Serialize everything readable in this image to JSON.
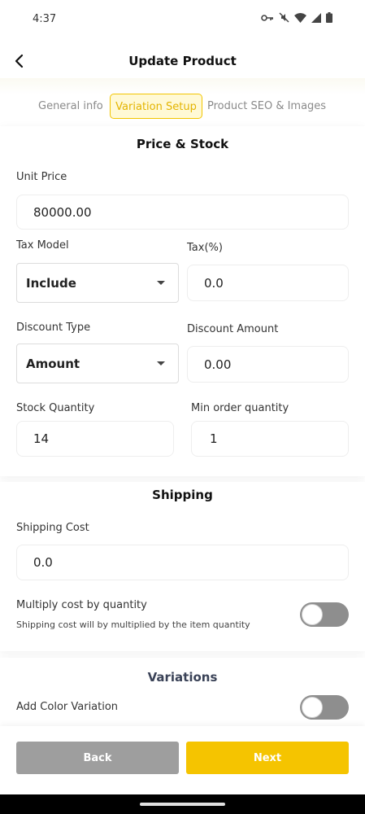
{
  "status_bar": {
    "time": "4:37",
    "icons": [
      "key-icon",
      "mute-icon",
      "wifi-icon",
      "signal-icon",
      "battery-icon"
    ]
  },
  "header": {
    "title": "Update Product",
    "back_icon": "back-arrow-icon"
  },
  "tabs": [
    {
      "label": "General info",
      "active": false
    },
    {
      "label": "Variation Setup",
      "active": true
    },
    {
      "label": "Product SEO & Images",
      "active": false
    }
  ],
  "price_stock": {
    "title": "Price & Stock",
    "unit_price": {
      "label": "Unit Price",
      "value": "80000.00"
    },
    "tax_model": {
      "label": "Tax Model",
      "value": "Include"
    },
    "tax": {
      "label": "Tax(%)",
      "value": "0.0"
    },
    "discount_type": {
      "label": "Discount Type",
      "value": "Amount"
    },
    "discount_amount": {
      "label": "Discount Amount",
      "value": "0.00"
    },
    "stock_quantity": {
      "label": "Stock Quantity",
      "value": "14"
    },
    "min_order_quantity": {
      "label": "Min order quantity",
      "value": "1"
    }
  },
  "shipping": {
    "title": "Shipping",
    "cost": {
      "label": "Shipping Cost",
      "value": "0.0"
    },
    "multiply": {
      "label": "Multiply cost by quantity",
      "note": "Shipping cost will by multiplied by the item quantity",
      "enabled": false
    }
  },
  "variations": {
    "title": "Variations",
    "color": {
      "label": "Add Color Variation",
      "enabled": false
    }
  },
  "footer": {
    "back_label": "Back",
    "next_label": "Next"
  },
  "colors": {
    "accent": "#f5c400",
    "back_button": "#9e9e9e",
    "toggle_off": "#8e8e8e"
  }
}
